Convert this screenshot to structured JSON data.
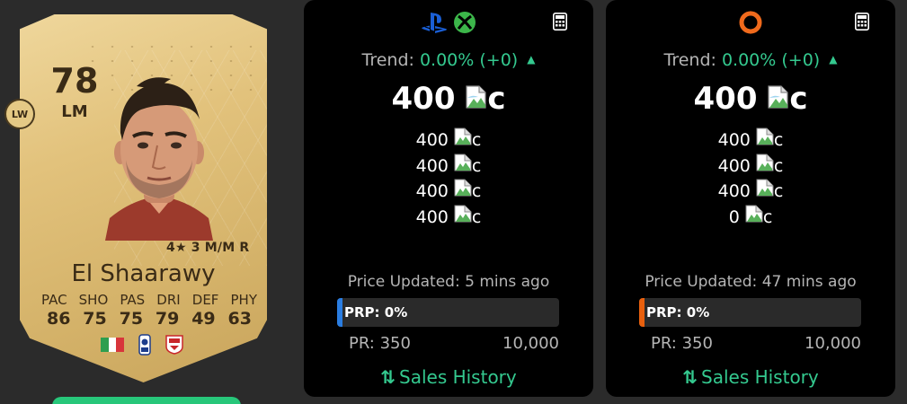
{
  "card": {
    "rating": "78",
    "position": "LM",
    "alt_position": "LW",
    "skills": "4★ 3 M/M R",
    "name": "El Shaarawy",
    "stat_labels": [
      "PAC",
      "SHO",
      "PAS",
      "DRI",
      "DEF",
      "PHY"
    ],
    "stat_values": [
      "86",
      "75",
      "75",
      "79",
      "49",
      "63"
    ],
    "card_color": "#e2c27c",
    "text_color": "#3a2b16",
    "nation_flag_colors": [
      "#2e9e4f",
      "#ffffff",
      "#d8353b"
    ],
    "icons": [
      "league-icon",
      "club-icon"
    ]
  },
  "panels": [
    {
      "platform": "console",
      "icons": [
        "playstation-icon",
        "xbox-icon"
      ],
      "calculator_icon": "calculator-icon",
      "trend_label": "Trend:",
      "trend_value": "0.00% (+0)",
      "main_price": "400",
      "coin_alt": "c",
      "prices": [
        "400",
        "400",
        "400",
        "400"
      ],
      "price_updated": "Price Updated: 5 mins ago",
      "prp": "PRP: 0%",
      "accent_color": "#2a7de1",
      "pr_min": "PR: 350",
      "pr_max": "10,000",
      "sales_history": "Sales History"
    },
    {
      "platform": "pc",
      "icons": [
        "origin-icon"
      ],
      "calculator_icon": "calculator-icon",
      "trend_label": "Trend:",
      "trend_value": "0.00% (+0)",
      "main_price": "400",
      "coin_alt": "c",
      "prices": [
        "400",
        "400",
        "400",
        "0"
      ],
      "price_updated": "Price Updated: 47 mins ago",
      "prp": "PRP: 0%",
      "accent_color": "#e8600e",
      "pr_min": "PR: 350",
      "pr_max": "10,000",
      "sales_history": "Sales History"
    }
  ],
  "colors": {
    "trend_green": "#34c98f",
    "panel_bg": "#000000",
    "page_bg": "#2b2b2b"
  }
}
